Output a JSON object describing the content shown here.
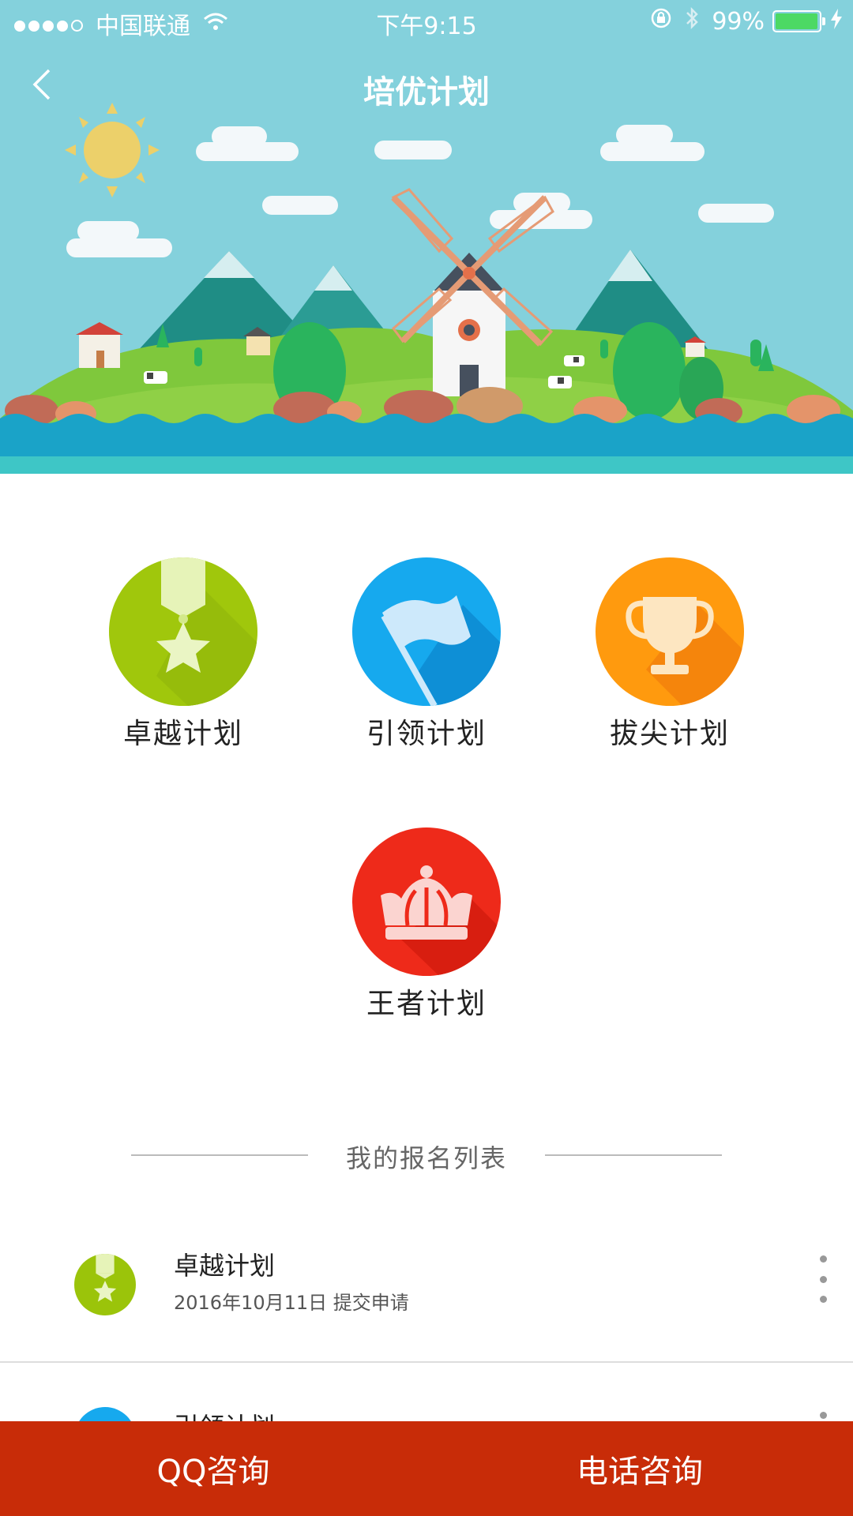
{
  "status_bar": {
    "carrier": "中国联通",
    "time": "下午9:15",
    "battery": "99%",
    "battery_level": 0.99,
    "signal_bars": 4,
    "signal_max": 5
  },
  "header": {
    "title": "培优计划",
    "back_icon": "chevron-left-icon"
  },
  "plans": [
    {
      "label": "卓越计划",
      "icon": "medal-icon",
      "color": "#9bc40a"
    },
    {
      "label": "引领计划",
      "icon": "flag-icon",
      "color": "#16a9ee"
    },
    {
      "label": "拔尖计划",
      "icon": "trophy-icon",
      "color": "#ff9a0e"
    },
    {
      "label": "王者计划",
      "icon": "crown-icon",
      "color": "#ee2a1a"
    }
  ],
  "section": {
    "title": "我的报名列表"
  },
  "registrations": [
    {
      "title": "卓越计划",
      "subtitle": "2016年10月11日 提交申请",
      "icon": "medal-icon"
    },
    {
      "title": "引领计划",
      "subtitle": "",
      "icon": "flag-icon"
    }
  ],
  "bottom_bar": {
    "qq_label": "QQ咨询",
    "phone_label": "电话咨询"
  },
  "colors": {
    "sky": "#84d1dc",
    "bottom_bar": "#c82c08"
  }
}
